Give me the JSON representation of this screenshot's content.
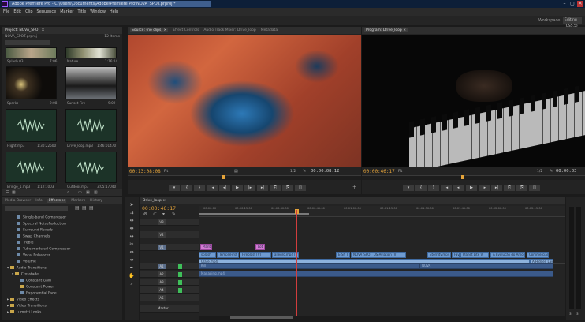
{
  "window": {
    "title": "Adobe Premiere Pro - C:\\Users\\Documents\\Adobe\\Premiere Pro\\NOVA_SPOT.prproj *",
    "controls": [
      "–",
      "▢",
      "✕"
    ]
  },
  "menu": [
    "File",
    "Edit",
    "Clip",
    "Sequence",
    "Marker",
    "Title",
    "Window",
    "Help"
  ],
  "workspace": {
    "label": "Workspace:",
    "value": "Editing (CS5.5)"
  },
  "project": {
    "tabs": [
      "Project: NOVA_SPOT ×"
    ],
    "file": "NOVA_SPOT.prproj",
    "count": "12 Items",
    "items": [
      {
        "name": "Splash 03",
        "dur": "7:06"
      },
      {
        "name": "Nature",
        "dur": "1:16:14"
      },
      {
        "name": "Sparks",
        "dur": "9:08"
      },
      {
        "name": "Sunset Fire",
        "dur": "9:09"
      },
      {
        "name": "Flight.mp3",
        "dur": "1:30:22500"
      },
      {
        "name": "Drive_loop.mp3",
        "dur": "1:46:01470"
      },
      {
        "name": "Bridge_1.mp3",
        "dur": "1:12:1003"
      },
      {
        "name": "Outdoor.mp3",
        "dur": "3:05:17040"
      }
    ]
  },
  "effects": {
    "tabs": [
      "Media Browser",
      "Info",
      "Effects ×",
      "Markers",
      "History"
    ],
    "items": [
      "Single-band Compressor",
      "Spectral NoiseReduction",
      "Surround Reverb",
      "Swap Channels",
      "Treble",
      "Tube-modeled Compressor",
      "Vocal Enhancer",
      "Volume",
      "Audio Transitions",
      "Crossfade",
      "Constant Gain",
      "Constant Power",
      "Exponential Fade",
      "Video Effects",
      "Video Transitions",
      "Lumetri Looks"
    ]
  },
  "source": {
    "tabs": [
      "Source: (no clips) ×",
      "Effect Controls",
      "Audio Track Mixer: Drive_loop",
      "Metadata"
    ],
    "tc_left": "00:13:08:08",
    "fit": "Fit",
    "half": "1/2",
    "tc_right": "00:00:08:12"
  },
  "program": {
    "tabs": [
      "Program: Drive_loop ×"
    ],
    "tc_left": "00:00:46:17",
    "fit": "Fit",
    "half": "1/2",
    "tc_right": "00:00:03"
  },
  "transport": [
    "▾",
    "{",
    "}",
    "|◂",
    "◂|",
    "▶",
    "|▸",
    "▸|",
    "⎗",
    "⎘",
    "◫"
  ],
  "timeline": {
    "tabs": [
      "Drive_loop ×"
    ],
    "timecode": "00:00:46:17",
    "ruler": [
      "00:00:00",
      "00:00:15:00",
      "00:00:30:00",
      "00:00:45:00",
      "00:01:00:00",
      "00:01:15:00",
      "00:01:30:00",
      "00:01:45:00",
      "00:02:00:00",
      "00:02:15:00",
      "00:02:30:00"
    ],
    "tracks": [
      "V3",
      "V2",
      "V1",
      "A1",
      "A2",
      "A3",
      "A4",
      "A5"
    ],
    "master": "Master",
    "clips": [
      {
        "label": "Plants"
      },
      {
        "label": "Lot"
      },
      {
        "label": "splash"
      },
      {
        "label": "TempleFirst"
      },
      {
        "label": "Fireblast [V]"
      },
      {
        "label": "allegro.mp4 [V]"
      },
      {
        "label": "E-Sh T"
      },
      {
        "label": "NOVA_SPOT_US-Aviation [V]"
      },
      {
        "label": "Eternity.mp4"
      },
      {
        "label": "Fav."
      },
      {
        "label": "Planet Lite V"
      },
      {
        "label": "A Evolução do Amor"
      },
      {
        "label": "Commercial Nov"
      },
      {
        "label": "Glare.mp4"
      },
      {
        "label": "A Hidden Law"
      },
      {
        "label": "Kill"
      },
      {
        "label": "NOVA"
      },
      {
        "label": "Managing.mp4"
      }
    ]
  },
  "audio_meter": {
    "labels": [
      "S",
      "S"
    ]
  }
}
